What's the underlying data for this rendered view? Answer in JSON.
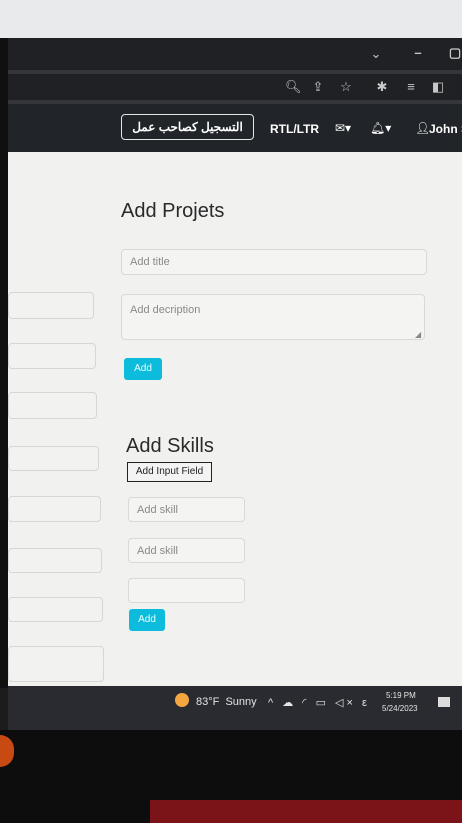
{
  "navbar": {
    "register_button": "التسجيل كصاحب عمل",
    "rtl_ltr": "RTL/LTR",
    "user_name": "John Sm"
  },
  "projects": {
    "heading": "Add Projets",
    "title_placeholder": "Add title",
    "description_placeholder": "Add decription",
    "add_button": "Add"
  },
  "skills": {
    "heading": "Add Skills",
    "add_input_button": "Add Input Field",
    "skill_fields": [
      {
        "placeholder": "Add skill"
      },
      {
        "placeholder": "Add skill"
      },
      {
        "placeholder": ""
      }
    ],
    "add_button": "Add"
  },
  "taskbar": {
    "weather": "83°F  Sunny",
    "time": "5:19 PM",
    "date": "5/24/2023"
  },
  "icons": [
    "minimize-icon",
    "maximize-icon",
    "chevron-down-icon",
    "zoom-icon",
    "share-icon",
    "star-icon",
    "extensions-icon",
    "media-icon",
    "sidepanel-icon",
    "mail-icon",
    "bell-icon",
    "user-icon",
    "weather-icon",
    "notification-icon"
  ],
  "colors": {
    "navbar": "#212529",
    "primary_button": "#0dbcdc",
    "page_background": "#f1f1f0"
  }
}
